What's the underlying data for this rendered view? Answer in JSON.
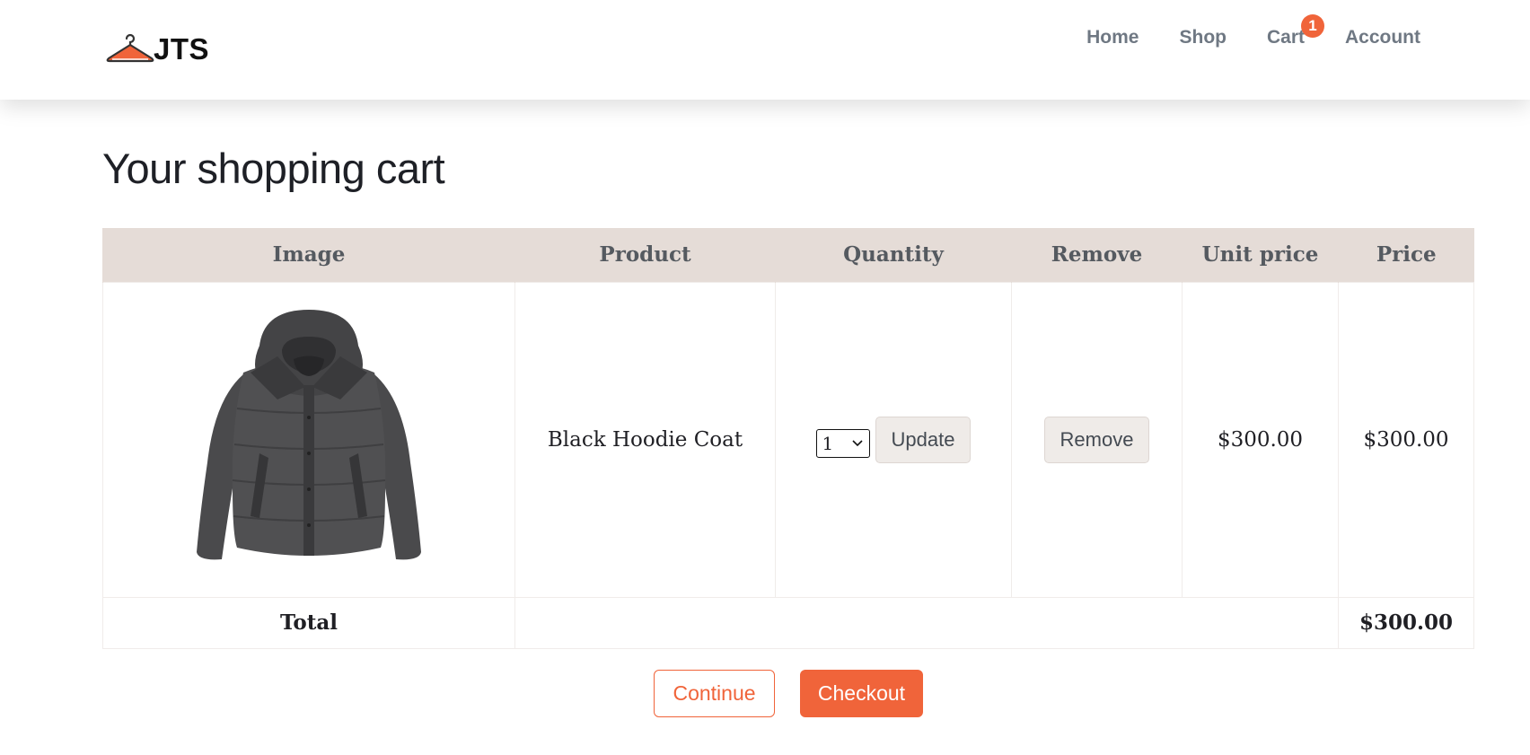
{
  "brand": {
    "name": "JTS",
    "logo_icon": "hanger-icon",
    "accent_color": "#f0643a"
  },
  "nav": {
    "items": [
      {
        "label": "Home"
      },
      {
        "label": "Shop"
      },
      {
        "label": "Cart",
        "badge": "1"
      },
      {
        "label": "Account"
      }
    ]
  },
  "page": {
    "title": "Your shopping cart"
  },
  "cart_table": {
    "headers": [
      "Image",
      "Product",
      "Quantity",
      "Remove",
      "Unit price",
      "Price"
    ],
    "items": [
      {
        "image_icon": "black-hoodie-coat-image",
        "product": "Black Hoodie Coat",
        "quantity": "1",
        "update_label": "Update",
        "remove_label": "Remove",
        "unit_price": "$300.00",
        "price": "$300.00"
      }
    ],
    "total_label": "Total",
    "total_value": "$300.00"
  },
  "actions": {
    "continue_label": "Continue",
    "checkout_label": "Checkout"
  }
}
